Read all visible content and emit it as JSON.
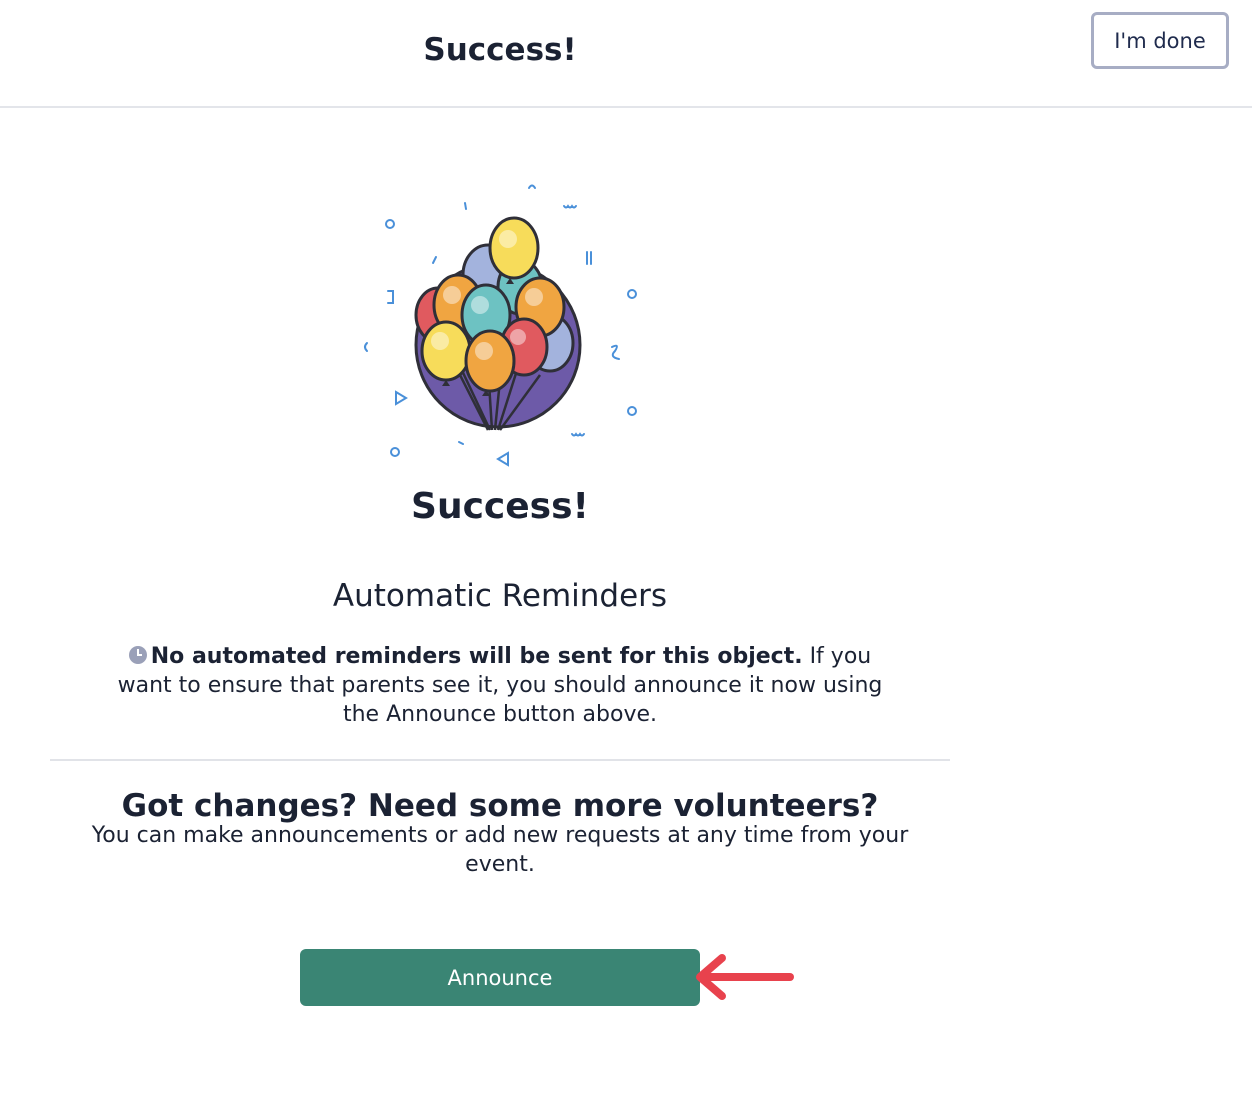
{
  "header": {
    "title": "Success!",
    "done_label": "I'm done"
  },
  "main": {
    "illustration_icon": "balloons-icon",
    "success_title": "Success!",
    "reminders_title": "Automatic Reminders",
    "reminders_bold": "No automated reminders will be sent for this object.",
    "reminders_text": " If you want to ensure that parents see it, you should announce it now using the Announce button above.",
    "changes_title": "Got changes? Need some more volunteers?",
    "changes_text": "You can make announcements or add new requests at any time from your event.",
    "announce_label": "Announce"
  },
  "colors": {
    "primary": "#3a8574",
    "done_border": "#a7adc4",
    "arrow": "#e8424d"
  }
}
